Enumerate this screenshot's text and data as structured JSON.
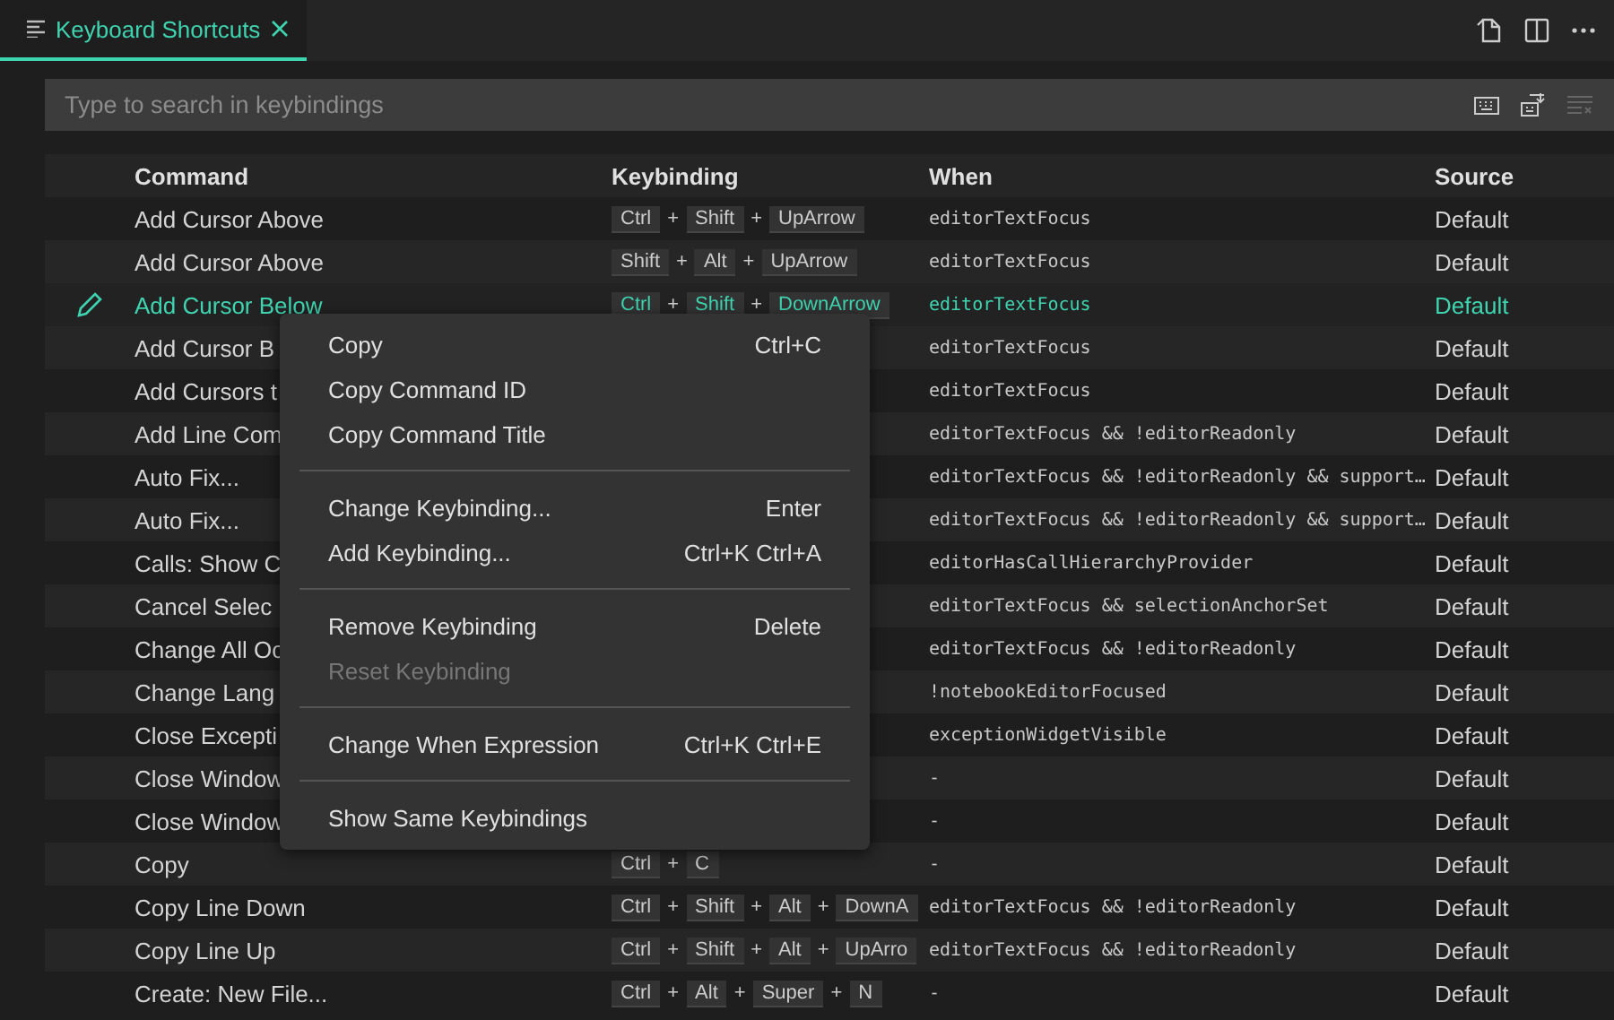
{
  "tab": {
    "label": "Keyboard Shortcuts",
    "selected": true
  },
  "search": {
    "placeholder": "Type to search in keybindings"
  },
  "table": {
    "columns": [
      "Command",
      "Keybinding",
      "When",
      "Source"
    ],
    "rows": [
      {
        "command": "Add Cursor Above",
        "keys": [
          "Ctrl",
          "+",
          "Shift",
          "+",
          "UpArrow"
        ],
        "when": "editorTextFocus",
        "source": "Default",
        "selected": false
      },
      {
        "command": "Add Cursor Above",
        "keys": [
          "Shift",
          "+",
          "Alt",
          "+",
          "UpArrow"
        ],
        "when": "editorTextFocus",
        "source": "Default",
        "selected": false
      },
      {
        "command": "Add Cursor Below",
        "keys": [
          "Ctrl",
          "+",
          "Shift",
          "+",
          "DownArrow"
        ],
        "when": "editorTextFocus",
        "source": "Default",
        "selected": true
      },
      {
        "command": "Add Cursor B",
        "keys": [],
        "when": "editorTextFocus",
        "source": "Default",
        "selected": false
      },
      {
        "command": "Add Cursors t",
        "keys": [],
        "when": "editorTextFocus",
        "source": "Default",
        "selected": false
      },
      {
        "command": "Add Line Com",
        "keys": [],
        "when": "editorTextFocus && !editorReadonly",
        "source": "Default",
        "selected": false
      },
      {
        "command": "Auto Fix...",
        "keys": [],
        "when": "editorTextFocus && !editorReadonly && support…",
        "source": "Default",
        "selected": false
      },
      {
        "command": "Auto Fix...",
        "keys": [],
        "when": "editorTextFocus && !editorReadonly && support…",
        "source": "Default",
        "selected": false
      },
      {
        "command": "Calls: Show C",
        "keys": [],
        "when": "editorHasCallHierarchyProvider",
        "source": "Default",
        "selected": false
      },
      {
        "command": "Cancel Selec",
        "keys": [],
        "when": "editorTextFocus && selectionAnchorSet",
        "source": "Default",
        "selected": false
      },
      {
        "command": "Change All Oc",
        "keys": [],
        "when": "editorTextFocus && !editorReadonly",
        "source": "Default",
        "selected": false
      },
      {
        "command": "Change Lang",
        "keys": [],
        "when": "!notebookEditorFocused",
        "source": "Default",
        "selected": false
      },
      {
        "command": "Close Excepti",
        "keys": [],
        "when": "exceptionWidgetVisible",
        "source": "Default",
        "selected": false
      },
      {
        "command": "Close Window",
        "keys": [],
        "when": "-",
        "source": "Default",
        "selected": false
      },
      {
        "command": "Close Window",
        "keys": [],
        "when": "-",
        "source": "Default",
        "selected": false
      },
      {
        "command": "Copy",
        "keys": [
          "Ctrl",
          "+",
          "C"
        ],
        "when": "-",
        "source": "Default",
        "selected": false
      },
      {
        "command": "Copy Line Down",
        "keys": [
          "Ctrl",
          "+",
          "Shift",
          "+",
          "Alt",
          "+",
          "DownA"
        ],
        "when": "editorTextFocus && !editorReadonly",
        "source": "Default",
        "selected": false
      },
      {
        "command": "Copy Line Up",
        "keys": [
          "Ctrl",
          "+",
          "Shift",
          "+",
          "Alt",
          "+",
          "UpArro"
        ],
        "when": "editorTextFocus && !editorReadonly",
        "source": "Default",
        "selected": false
      },
      {
        "command": "Create: New File...",
        "keys": [
          "Ctrl",
          "+",
          "Alt",
          "+",
          "Super",
          "+",
          "N"
        ],
        "when": "-",
        "source": "Default",
        "selected": false
      }
    ]
  },
  "context_menu": {
    "groups": [
      [
        {
          "label": "Copy",
          "shortcut": "Ctrl+C",
          "disabled": false
        },
        {
          "label": "Copy Command ID",
          "disabled": false
        },
        {
          "label": "Copy Command Title",
          "disabled": false
        }
      ],
      [
        {
          "label": "Change Keybinding...",
          "shortcut": "Enter",
          "disabled": false
        },
        {
          "label": "Add Keybinding...",
          "shortcut": "Ctrl+K Ctrl+A",
          "disabled": false
        }
      ],
      [
        {
          "label": "Remove Keybinding",
          "shortcut": "Delete",
          "disabled": false
        },
        {
          "label": "Reset Keybinding",
          "disabled": true
        }
      ],
      [
        {
          "label": "Change When Expression",
          "shortcut": "Ctrl+K Ctrl+E",
          "disabled": false
        }
      ],
      [
        {
          "label": "Show Same Keybindings",
          "disabled": false
        }
      ]
    ]
  }
}
